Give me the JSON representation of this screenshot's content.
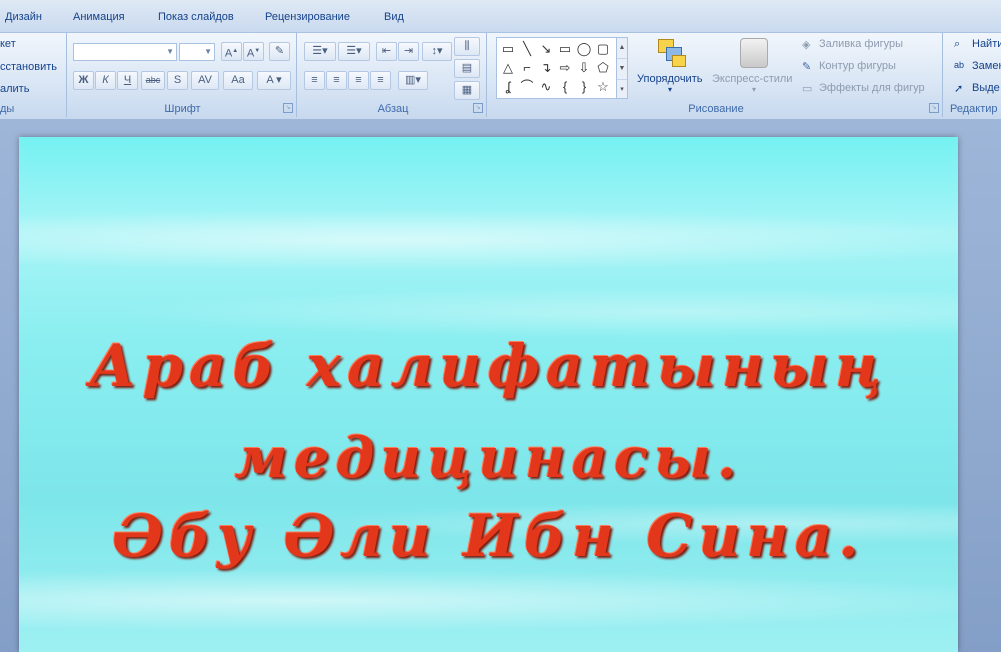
{
  "tabs": [
    "Дизайн",
    "Анимация",
    "Показ слайдов",
    "Рецензирование",
    "Вид"
  ],
  "clipboard": {
    "items": [
      "кет",
      "сстановить",
      "алить"
    ],
    "label": "ды"
  },
  "font_group": {
    "label": "Шрифт"
  },
  "paragraph_group": {
    "label": "Абзац"
  },
  "drawing_group": {
    "label": "Рисование",
    "arrange": "Упорядочить",
    "quick_styles": "Экспресс-стили",
    "shape_fill": "Заливка фигуры",
    "shape_outline": "Контур фигуры",
    "shape_effects": "Эффекты для фигур"
  },
  "editing_group": {
    "label": "Редактир",
    "find": "Найти",
    "replace": "Замен",
    "select": "Выде"
  },
  "slide": {
    "line1": "Араб  халифатының",
    "line2": "медицинасы.",
    "line3": "Әбу  Әли  Ибн  Сина."
  }
}
